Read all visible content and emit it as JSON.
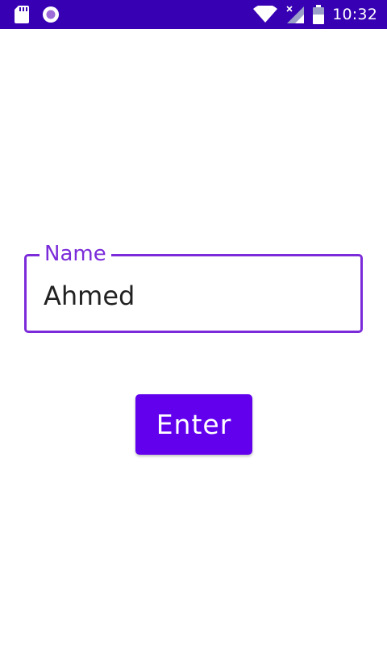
{
  "status_bar": {
    "time": "10:32",
    "background": "#3700b3",
    "left_icons": [
      "sd-card-icon",
      "record-icon"
    ],
    "right_icons": [
      "wifi-icon",
      "cell-signal-off-icon",
      "battery-icon"
    ]
  },
  "form": {
    "name_field": {
      "label": "Name",
      "value": "Ahmed",
      "accent": "#7b2bd9"
    },
    "enter_button": {
      "label": "Enter",
      "color": "#6200ee"
    }
  }
}
